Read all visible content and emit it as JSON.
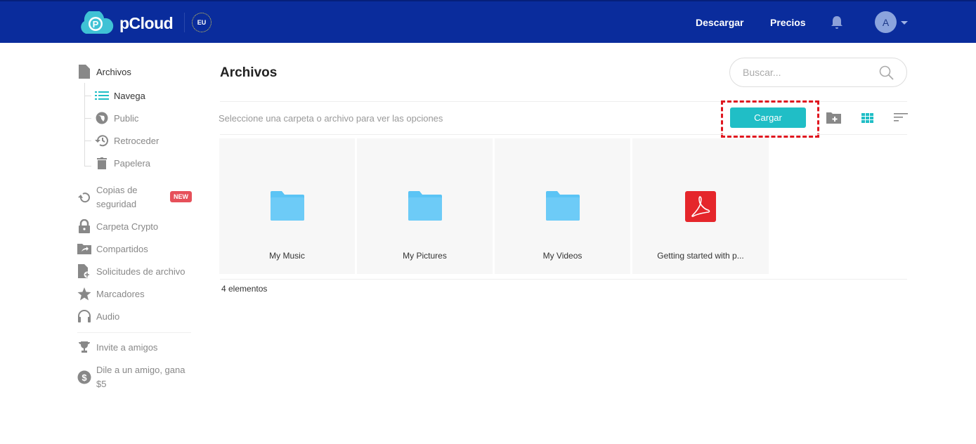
{
  "header": {
    "brand": "pCloud",
    "region": "EU",
    "nav": [
      "Descargar",
      "Precios"
    ],
    "avatar": "A",
    "color": "#0a2c9c"
  },
  "sidebar": {
    "items": [
      {
        "label": "Archivos",
        "icon": "file-icon"
      },
      {
        "label": "Navega",
        "icon": "list-icon"
      },
      {
        "label": "Public",
        "icon": "globe-icon"
      },
      {
        "label": "Retroceder",
        "icon": "history-icon"
      },
      {
        "label": "Papelera",
        "icon": "trash-icon"
      },
      {
        "label": "Copias de seguridad",
        "icon": "backup-icon",
        "badge": "NEW"
      },
      {
        "label": "Carpeta Crypto",
        "icon": "lock-icon"
      },
      {
        "label": "Compartidos",
        "icon": "shared-folder-icon"
      },
      {
        "label": "Solicitudes de archivo",
        "icon": "file-request-icon"
      },
      {
        "label": "Marcadores",
        "icon": "star-icon"
      },
      {
        "label": "Audio",
        "icon": "headphones-icon"
      },
      {
        "label": "Invite a amigos",
        "icon": "trophy-icon"
      },
      {
        "label": "Dile a un amigo, gana $5",
        "icon": "dollar-icon"
      }
    ]
  },
  "main": {
    "title": "Archivos",
    "search_placeholder": "Buscar...",
    "hint": "Seleccione una carpeta o archivo para ver las opciones",
    "upload_label": "Cargar",
    "accent": "#20bec6",
    "files": [
      {
        "name": "My Music",
        "type": "folder"
      },
      {
        "name": "My Pictures",
        "type": "folder"
      },
      {
        "name": "My Videos",
        "type": "folder"
      },
      {
        "name": "Getting started with p...",
        "type": "pdf"
      }
    ],
    "count": "4 elementos"
  }
}
